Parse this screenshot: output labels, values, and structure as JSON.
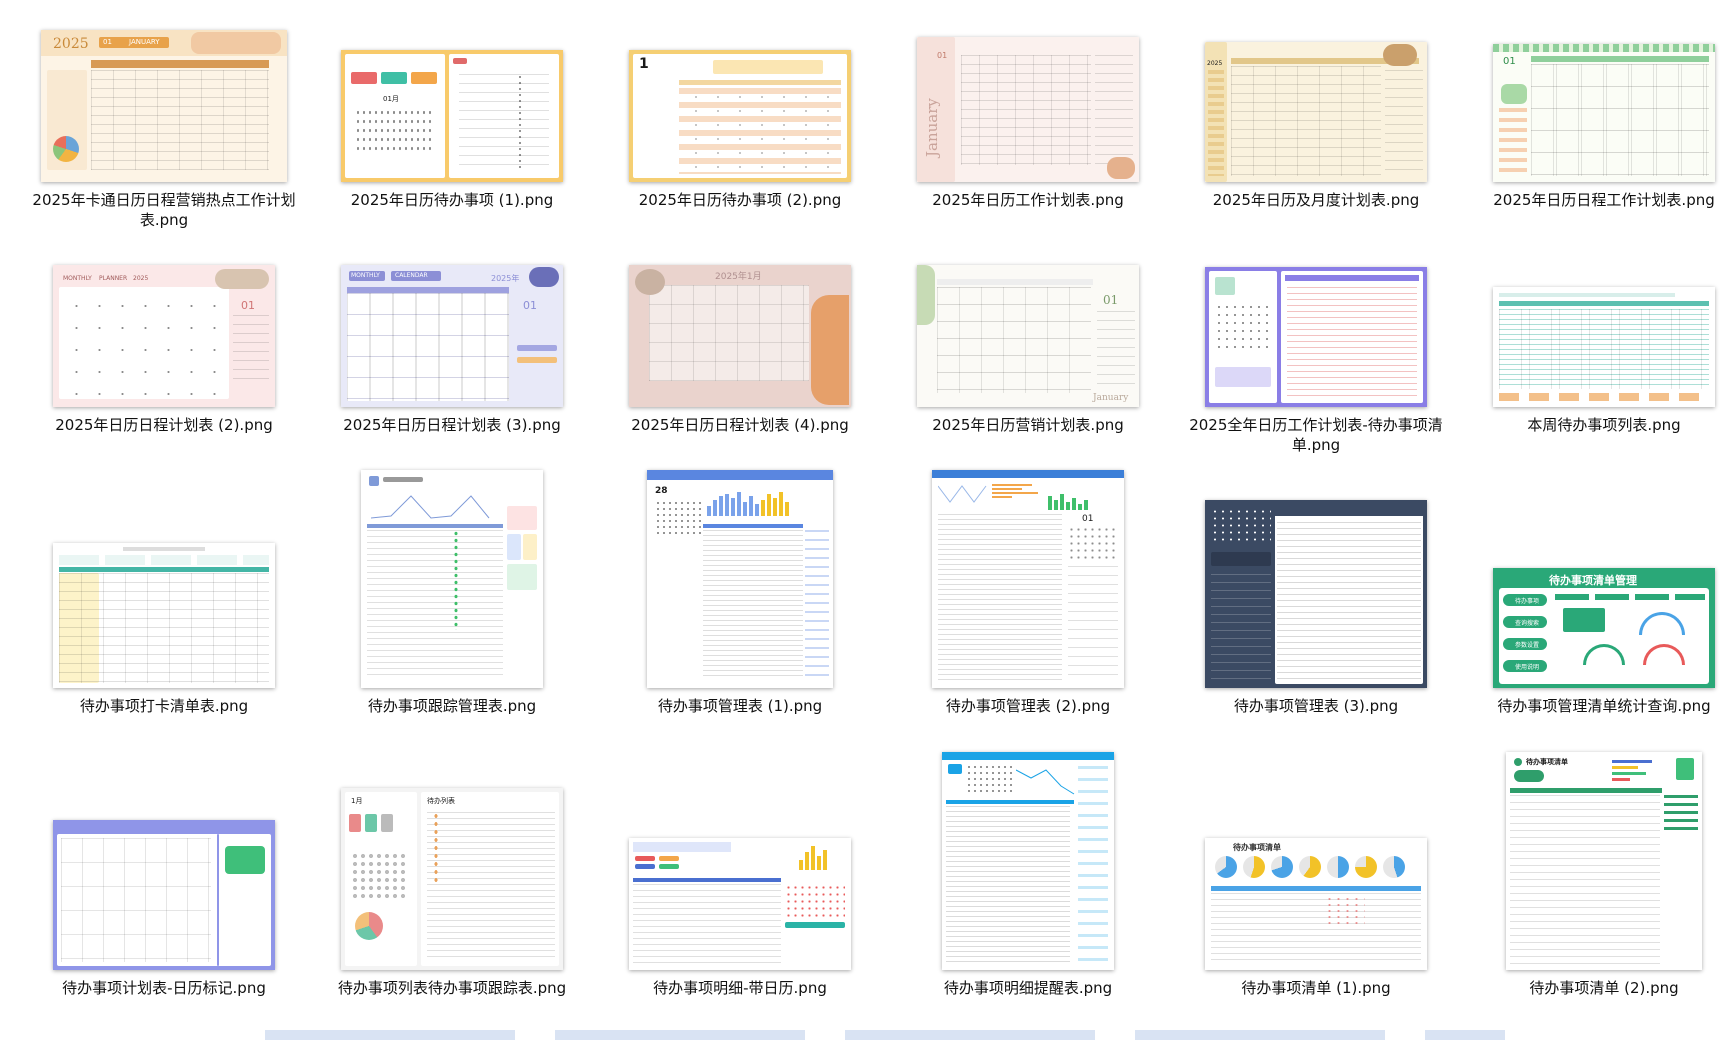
{
  "files": [
    {
      "name": "2025年卡通日历日程营销热点工作计划表.png",
      "thumb_text": [
        "2025",
        "01",
        "JANUARY"
      ],
      "accent": "#e8a24a"
    },
    {
      "name": "2025年日历待办事项 (1).png",
      "thumb_text": [
        "01月"
      ],
      "accent": "#f2c66b"
    },
    {
      "name": "2025年日历待办事项 (2).png",
      "thumb_text": [
        "1"
      ],
      "accent": "#f5cf73"
    },
    {
      "name": "2025年日历工作计划表.png",
      "thumb_text": [
        "01",
        "January"
      ],
      "accent": "#e9b6a6"
    },
    {
      "name": "2025年日历及月度计划表.png",
      "thumb_text": [
        "2025"
      ],
      "accent": "#e2c78a"
    },
    {
      "name": "2025年日历日程工作计划表.png",
      "thumb_text": [
        "01"
      ],
      "accent": "#8fcf9b"
    },
    {
      "name": "2025年日历日程计划表 (2).png",
      "thumb_text": [
        "MONTHLY",
        "PLANNER",
        "2025",
        "01"
      ],
      "accent": "#f4c4c4"
    },
    {
      "name": "2025年日历日程计划表 (3).png",
      "thumb_text": [
        "MONTHLY",
        "CALENDAR",
        "2025年",
        "01"
      ],
      "accent": "#8c8fd6"
    },
    {
      "name": "2025年日历日程计划表 (4).png",
      "thumb_text": [
        "2025年1月"
      ],
      "accent": "#e6a06a"
    },
    {
      "name": "2025年日历营销计划表.png",
      "thumb_text": [
        "01",
        "January"
      ],
      "accent": "#b9d3a6"
    },
    {
      "name": "2025全年日历工作计划表-待办事项清单.png",
      "thumb_text": [],
      "accent": "#8a7ee6"
    },
    {
      "name": "本周待办事项列表.png",
      "thumb_text": [],
      "accent": "#5cc0b0"
    },
    {
      "name": "待办事项打卡清单表.png",
      "thumb_text": [],
      "accent": "#44b6a6"
    },
    {
      "name": "待办事项跟踪管理表.png",
      "thumb_text": [],
      "accent": "#7f9ad8"
    },
    {
      "name": "待办事项管理表 (1).png",
      "thumb_text": [
        "28"
      ],
      "accent": "#5a86e0"
    },
    {
      "name": "待办事项管理表 (2).png",
      "thumb_text": [
        "01"
      ],
      "accent": "#3c7fd8"
    },
    {
      "name": "待办事项管理表 (3).png",
      "thumb_text": [],
      "accent": "#3b4a63"
    },
    {
      "name": "待办事项管理清单统计查询.png",
      "thumb_text": [
        "待办事项清单管理",
        "待办事项",
        "查询搜索",
        "参数设置",
        "使用说明"
      ],
      "accent": "#2aa878"
    },
    {
      "name": "待办事项计划表-日历标记.png",
      "thumb_text": [],
      "accent": "#8f95e8"
    },
    {
      "name": "待办事项列表待办事项跟踪表.png",
      "thumb_text": [
        "1月",
        "待办列表"
      ],
      "accent": "#e98a8a"
    },
    {
      "name": "待办事项明细-带日历.png",
      "thumb_text": [],
      "accent": "#4a6fd0"
    },
    {
      "name": "待办事项明细提醒表.png",
      "thumb_text": [],
      "accent": "#1aa3e6"
    },
    {
      "name": "待办事项清单 (1).png",
      "thumb_text": [
        "待办事项清单"
      ],
      "accent": "#f2c228"
    },
    {
      "name": "待办事项清单 (2).png",
      "thumb_text": [
        "待办事项清单"
      ],
      "accent": "#2f9e6b"
    }
  ]
}
